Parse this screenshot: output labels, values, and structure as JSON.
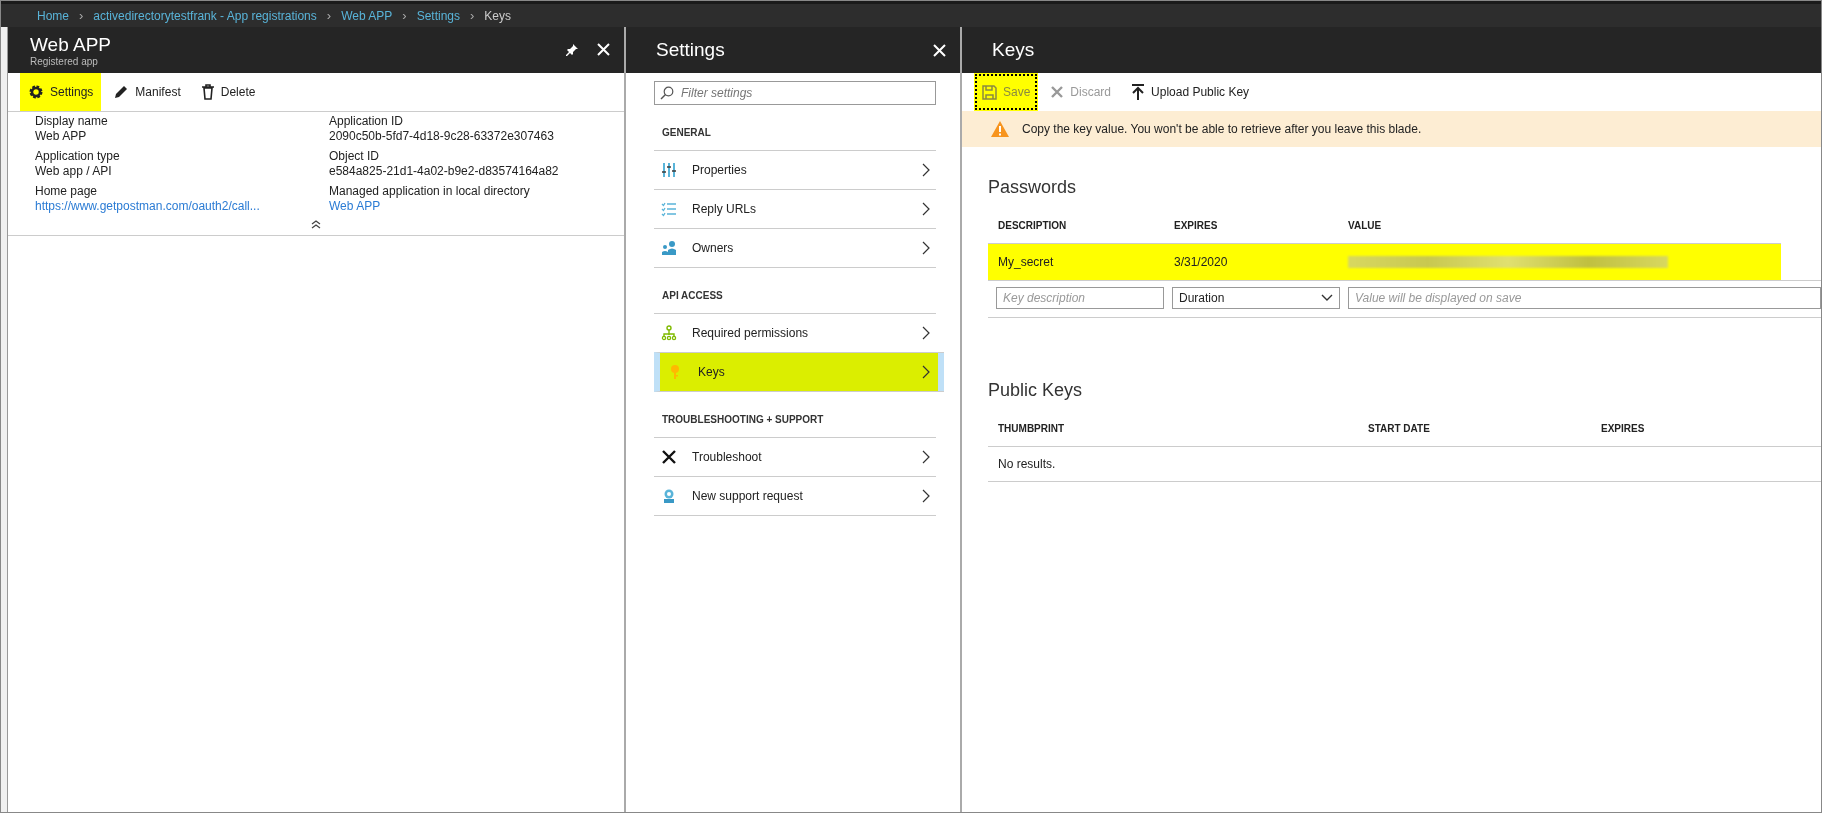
{
  "breadcrumb_separator": "›",
  "breadcrumb": [
    {
      "label": "Home",
      "link": true
    },
    {
      "label": "activedirectorytestfrank - App registrations",
      "link": true
    },
    {
      "label": "Web APP",
      "link": true
    },
    {
      "label": "Settings",
      "link": true
    },
    {
      "label": "Keys",
      "link": false
    }
  ],
  "app_blade": {
    "title": "Web APP",
    "subtitle": "Registered app",
    "toolbar": [
      {
        "kind": "gear",
        "label": "Settings",
        "highlighted": true
      },
      {
        "kind": "pencil",
        "label": "Manifest",
        "highlighted": false
      },
      {
        "kind": "trash",
        "label": "Delete",
        "highlighted": false
      }
    ],
    "columns": [
      [
        {
          "label": "Display name",
          "value": "Web APP",
          "link": false
        },
        {
          "label": "Application type",
          "value": "Web app / API",
          "link": false
        },
        {
          "label": "Home page",
          "value": "https://www.getpostman.com/oauth2/call...",
          "link": true
        }
      ],
      [
        {
          "label": "Application ID",
          "value": "2090c50b-5fd7-4d18-9c28-63372e307463",
          "link": false
        },
        {
          "label": "Object ID",
          "value": "e584a825-21d1-4a02-b9e2-d83574164a82",
          "link": false
        },
        {
          "label": "Managed application in local directory",
          "value": "Web APP",
          "link": true
        }
      ]
    ]
  },
  "settings_blade": {
    "title": "Settings",
    "filter": {
      "placeholder": "Filter settings"
    },
    "sections": [
      {
        "heading": "GENERAL",
        "items": [
          {
            "kind": "properties",
            "label": "Properties",
            "selected": false
          },
          {
            "kind": "list",
            "label": "Reply URLs",
            "selected": false
          },
          {
            "kind": "people",
            "label": "Owners",
            "selected": false
          }
        ]
      },
      {
        "heading": "API ACCESS",
        "items": [
          {
            "kind": "tree",
            "label": "Required permissions",
            "selected": false
          },
          {
            "kind": "key",
            "label": "Keys",
            "selected": true
          }
        ]
      },
      {
        "heading": "TROUBLESHOOTING + SUPPORT",
        "items": [
          {
            "kind": "tools",
            "label": "Troubleshoot",
            "selected": false
          },
          {
            "kind": "support",
            "label": "New support request",
            "selected": false
          }
        ]
      }
    ]
  },
  "keys_blade": {
    "title": "Keys",
    "toolbar": [
      {
        "kind": "save",
        "label": "Save",
        "disabled": true,
        "highlighted": true
      },
      {
        "kind": "discard",
        "label": "Discard",
        "disabled": true,
        "highlighted": false
      },
      {
        "kind": "upload",
        "label": "Upload Public Key",
        "disabled": false,
        "highlighted": false
      }
    ],
    "warning": "Copy the key value. You won't be able to retrieve after you leave this blade.",
    "passwords": {
      "heading": "Passwords",
      "columns": [
        "DESCRIPTION",
        "EXPIRES",
        "VALUE"
      ],
      "rows": [
        {
          "description": "My_secret",
          "expires": "3/31/2020",
          "highlighted": true
        }
      ],
      "new_row": {
        "description_placeholder": "Key description",
        "duration": "Duration",
        "value_placeholder": "Value will be displayed on save"
      }
    },
    "public_keys": {
      "heading": "Public Keys",
      "columns": [
        "THUMBPRINT",
        "START DATE",
        "EXPIRES"
      ],
      "empty": "No results."
    }
  }
}
